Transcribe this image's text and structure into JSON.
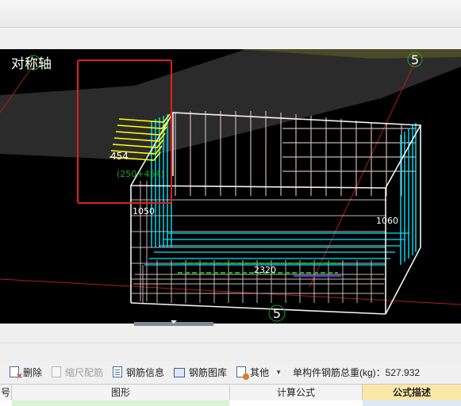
{
  "viewport": {
    "symmetry_axis_label": "对称轴",
    "axis_top_label": "5",
    "axis_bottom_label": "5",
    "dim_454": "454",
    "dim_formula": "(250+454)",
    "dim_1050": "1050",
    "dim_1060": "1060",
    "dim_2320": "2320"
  },
  "toolbar": {
    "delete_label": "删除",
    "scale_label": "缩尺配筋",
    "rebar_info_label": "钢筋信息",
    "rebar_library_label": "钢筋图库",
    "other_label": "其他",
    "total_weight_label": "单构件钢筋总重(kg)：527.932"
  },
  "grid": {
    "columns": [
      "号",
      "图形",
      "计算公式",
      "公式描述"
    ]
  },
  "colors": {
    "viewport_bg": "#000000",
    "rebar_cyan": "#00e5ff",
    "rebar_yellow": "#ffff00",
    "cage_lines": "#c8b4b4",
    "highlight_box": "#e02020",
    "dimension_green": "#1fa81f",
    "header_highlight": "#fbe7a6"
  }
}
